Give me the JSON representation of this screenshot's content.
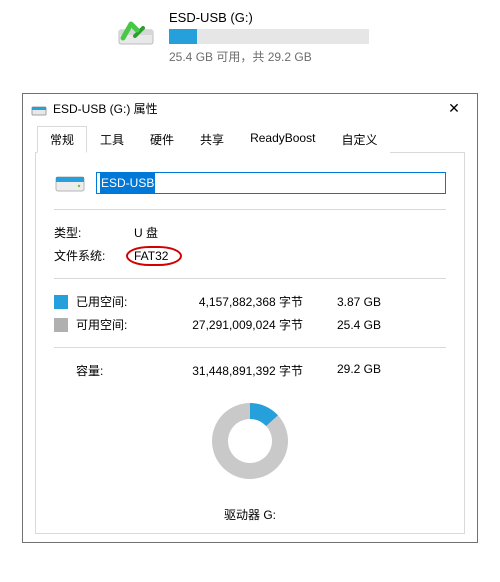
{
  "drive": {
    "name": "ESD-USB (G:)",
    "usage_text": "25.4 GB 可用，共 29.2 GB",
    "used_fraction": 0.14
  },
  "dialog": {
    "title": "ESD-USB (G:) 属性",
    "tabs": {
      "general": "常规",
      "tools": "工具",
      "hardware": "硬件",
      "sharing": "共享",
      "readyboost": "ReadyBoost",
      "customize": "自定义"
    },
    "name_value": "ESD-USB",
    "type_label": "类型:",
    "type_value": "U 盘",
    "fs_label": "文件系统:",
    "fs_value": "FAT32",
    "used_label": "已用空间:",
    "used_bytes": "4,157,882,368 字节",
    "used_human": "3.87 GB",
    "free_label": "可用空间:",
    "free_bytes": "27,291,009,024 字节",
    "free_human": "25.4 GB",
    "capacity_label": "容量:",
    "capacity_bytes": "31,448,891,392 字节",
    "capacity_human": "29.2 GB",
    "donut_caption": "驱动器 G:"
  },
  "chart_data": {
    "type": "pie",
    "title": "驱动器 G:",
    "series": [
      {
        "name": "已用空间",
        "value": 4157882368,
        "color": "#26a0da"
      },
      {
        "name": "可用空间",
        "value": 27291009024,
        "color": "#c9c9c9"
      }
    ],
    "total": 31448891392
  }
}
